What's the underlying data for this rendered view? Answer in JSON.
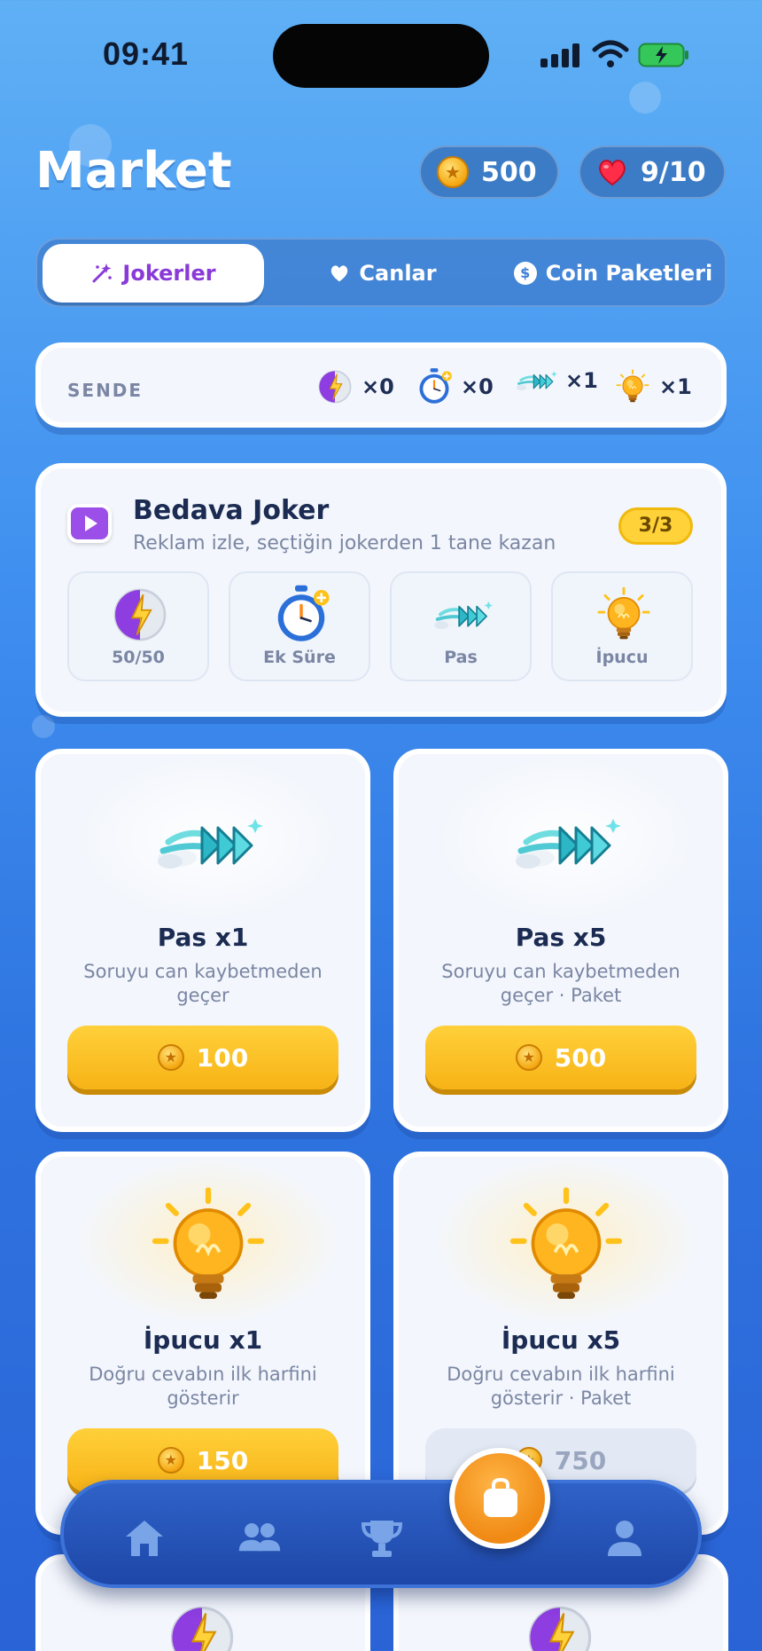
{
  "status_bar": {
    "time": "09:41"
  },
  "header": {
    "title": "Market",
    "coins": "500",
    "lives": "9/10"
  },
  "tabs": [
    {
      "label": "Jokerler",
      "icon": "magic-wand-icon",
      "active": true
    },
    {
      "label": "Canlar",
      "icon": "heart-icon",
      "active": false
    },
    {
      "label": "Coin Paketleri",
      "icon": "dollar-coin-icon",
      "active": false
    }
  ],
  "inventory": {
    "label": "SENDE",
    "items": [
      {
        "name": "50/50",
        "icon": "fifty-fifty-icon",
        "count": "×0"
      },
      {
        "name": "Ek Süre",
        "icon": "stopwatch-icon",
        "count": "×0"
      },
      {
        "name": "Pas",
        "icon": "skip-arrows-icon",
        "count": "×1"
      },
      {
        "name": "İpucu",
        "icon": "lightbulb-icon",
        "count": "×1"
      }
    ]
  },
  "free_joker": {
    "title": "Bedava Joker",
    "subtitle": "Reklam izle, seçtiğin jokerden 1 tane kazan",
    "badge": "3/3",
    "options": [
      {
        "label": "50/50",
        "icon": "fifty-fifty-icon"
      },
      {
        "label": "Ek Süre",
        "icon": "stopwatch-icon"
      },
      {
        "label": "Pas",
        "icon": "skip-arrows-icon"
      },
      {
        "label": "İpucu",
        "icon": "lightbulb-icon"
      }
    ]
  },
  "products": [
    {
      "name": "Pas x1",
      "desc": "Soruyu can kaybetmeden geçer",
      "price": "100",
      "icon": "skip-arrows-icon",
      "enabled": true
    },
    {
      "name": "Pas x5",
      "desc": "Soruyu can kaybetmeden geçer · Paket",
      "price": "500",
      "icon": "skip-arrows-icon",
      "enabled": true
    },
    {
      "name": "İpucu x1",
      "desc": "Doğru cevabın ilk harfini gösterir",
      "price": "150",
      "icon": "lightbulb-icon",
      "enabled": true
    },
    {
      "name": "İpucu x5",
      "desc": "Doğru cevabın ilk harfini gösterir · Paket",
      "price": "750",
      "icon": "lightbulb-icon",
      "enabled": false
    }
  ],
  "bottom_nav": [
    {
      "name": "home",
      "icon": "home-icon"
    },
    {
      "name": "friends",
      "icon": "people-icon"
    },
    {
      "name": "leaderboard",
      "icon": "trophy-icon"
    },
    {
      "name": "market",
      "icon": "shopping-bag-icon",
      "active": true
    },
    {
      "name": "profile",
      "icon": "person-icon"
    }
  ],
  "colors": {
    "accent_purple": "#8a3ad8",
    "gold": "#f7b316",
    "background_blue": "#3f8ff0"
  }
}
